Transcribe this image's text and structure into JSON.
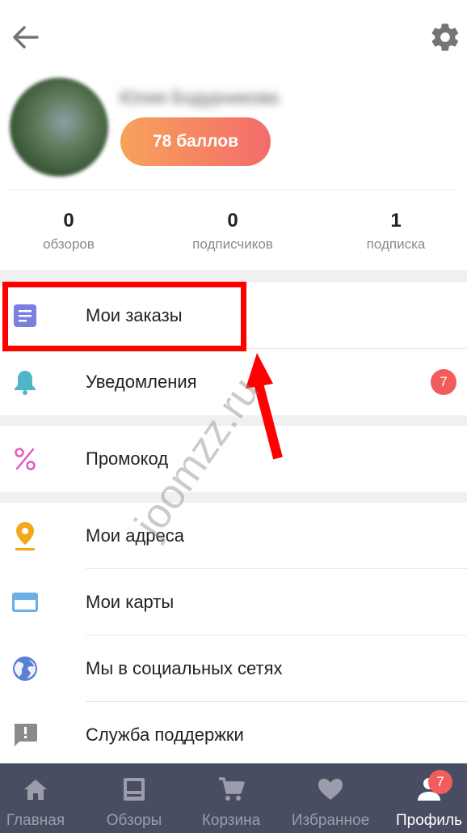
{
  "header": {
    "back_icon": "arrow-left-icon",
    "settings_icon": "gear-icon"
  },
  "profile": {
    "name": "Юлия Бодурникова",
    "points_label": "78 баллов"
  },
  "stats": [
    {
      "value": "0",
      "label": "обзоров"
    },
    {
      "value": "0",
      "label": "подписчиков"
    },
    {
      "value": "1",
      "label": "подписка"
    }
  ],
  "menu": {
    "orders": {
      "label": "Мои заказы",
      "icon": "document-icon",
      "color": "#7b7fe0"
    },
    "notifications": {
      "label": "Уведомления",
      "icon": "bell-icon",
      "color": "#4fb6c9",
      "badge": "7"
    },
    "promo": {
      "label": "Промокод",
      "icon": "percent-icon",
      "color": "#e05bc2"
    },
    "addresses": {
      "label": "Мои адреса",
      "icon": "location-pin-icon",
      "color": "#f3a81c"
    },
    "cards": {
      "label": "Мои карты",
      "icon": "credit-card-icon",
      "color": "#6ab0e6"
    },
    "social": {
      "label": "Мы в социальных сетях",
      "icon": "globe-icon",
      "color": "#5a7fd6"
    },
    "support": {
      "label": "Служба поддержки",
      "icon": "feedback-icon",
      "color": "#8a8a8a"
    }
  },
  "watermark": "joomzz.ru",
  "bottom_nav": {
    "items": [
      {
        "label": "Главная",
        "icon": "home-icon"
      },
      {
        "label": "Обзоры",
        "icon": "reviews-icon"
      },
      {
        "label": "Корзина",
        "icon": "cart-icon"
      },
      {
        "label": "Избранное",
        "icon": "heart-icon"
      },
      {
        "label": "Профиль",
        "icon": "person-icon"
      }
    ],
    "active_index": 4,
    "profile_badge": "7"
  },
  "colors": {
    "accent_gradient_start": "#f6a35a",
    "accent_gradient_end": "#f46b6b",
    "nav_background": "#494d61",
    "highlight": "#ff0000",
    "badge": "#f25c5c"
  }
}
